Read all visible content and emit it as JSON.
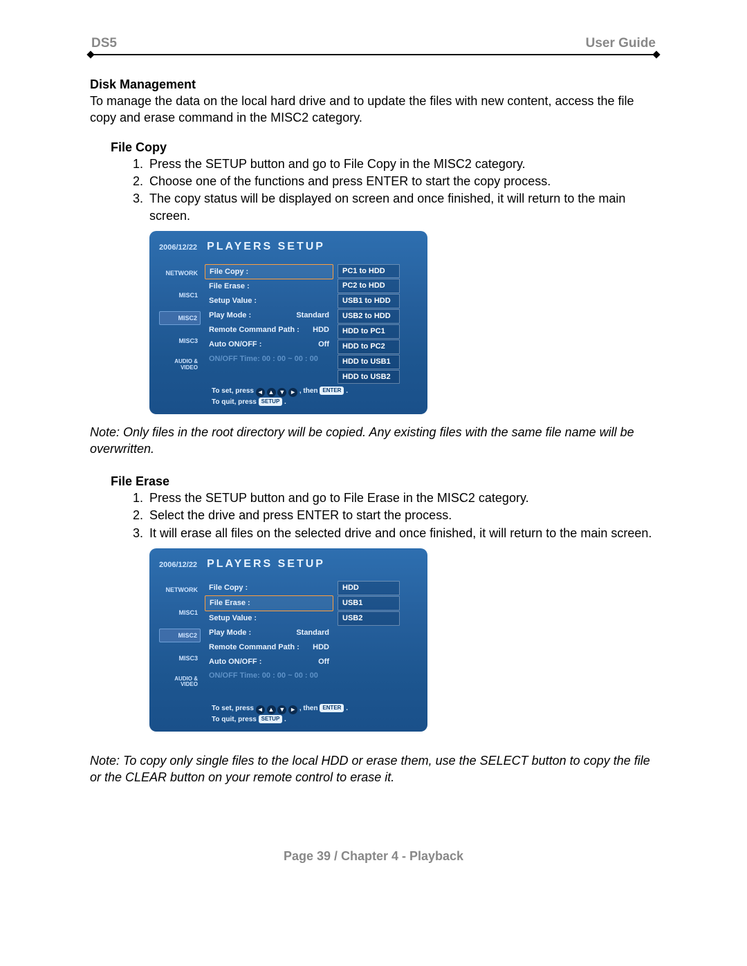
{
  "header": {
    "left": "DS5",
    "right": "User Guide"
  },
  "disk_mgmt": {
    "title": "Disk Management",
    "body": "To manage the data on the local hard drive and to update the files with new content, access the file copy and erase command in the MISC2 category."
  },
  "file_copy": {
    "title": "File Copy",
    "steps": [
      "Press the SETUP button and go to File Copy in the MISC2 category.",
      "Choose one of the functions and press ENTER to start the copy process.",
      "The copy status will be displayed on screen and once finished, it will return to the main screen."
    ],
    "note": "Note: Only files in the root directory will be copied. Any existing files with the same file name will be overwritten."
  },
  "file_erase": {
    "title": "File Erase",
    "steps": [
      "Press the SETUP button and go to File Erase in the MISC2 category.",
      "Select the drive and press ENTER to start the process.",
      "It will erase all files on the selected drive and once finished, it will return to the main screen."
    ]
  },
  "final_note": "Note: To copy only single files to the local HDD or erase them, use the SELECT button to copy the file or the CLEAR button on your remote control to erase it.",
  "footer": "Page 39  /  Chapter 4 - Playback",
  "screen_common": {
    "date": "2006/12/22",
    "title": "PLAYERS SETUP",
    "sidebar": [
      "NETWORK",
      "MISC1",
      "MISC2",
      "MISC3",
      "AUDIO & VIDEO"
    ],
    "hint_set": "To set, press",
    "hint_then": ", then",
    "enter": "ENTER",
    "hint_quit": "To quit, press",
    "setup": "SETUP",
    "arrow_left": "◄",
    "arrow_up": "▲",
    "arrow_down": "▼",
    "arrow_right": "►"
  },
  "screen1": {
    "highlight": 0,
    "rows": [
      {
        "label": "File Copy :",
        "val": ""
      },
      {
        "label": "File Erase :",
        "val": ""
      },
      {
        "label": "Setup Value :",
        "val": ""
      },
      {
        "label": "Play Mode :",
        "val": "Standard"
      },
      {
        "label": "Remote Command Path :",
        "val": "HDD"
      },
      {
        "label": "Auto ON/OFF :",
        "val": "Off"
      },
      {
        "label": "ON/OFF Time: 00 : 00 ~ 00 : 00",
        "val": "",
        "disabled": true
      }
    ],
    "options": [
      "PC1 to HDD",
      "PC2 to HDD",
      "USB1 to HDD",
      "USB2 to HDD",
      "HDD to PC1",
      "HDD to PC2",
      "HDD to USB1",
      "HDD to USB2"
    ]
  },
  "screen2": {
    "highlight": 1,
    "rows": [
      {
        "label": "File Copy :",
        "val": ""
      },
      {
        "label": "File Erase :",
        "val": ""
      },
      {
        "label": "Setup Value :",
        "val": ""
      },
      {
        "label": "Play Mode :",
        "val": "Standard"
      },
      {
        "label": "Remote Command Path :",
        "val": "HDD"
      },
      {
        "label": "Auto ON/OFF :",
        "val": "Off"
      },
      {
        "label": "ON/OFF Time: 00 : 00 ~ 00 : 00",
        "val": "",
        "disabled": true
      }
    ],
    "options": [
      "HDD",
      "USB1",
      "USB2"
    ]
  }
}
